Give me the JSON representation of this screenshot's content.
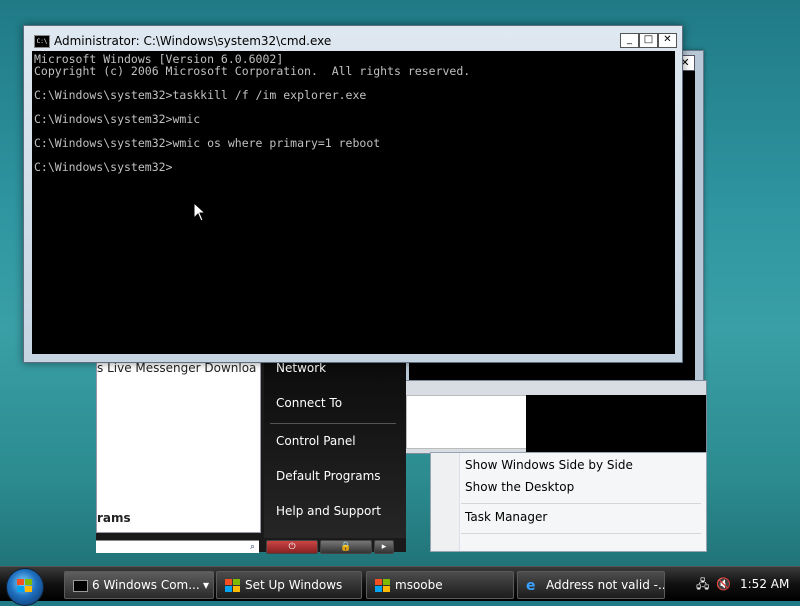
{
  "cmd_window": {
    "title": "Administrator: C:\\Windows\\system32\\cmd.exe",
    "icon_label": "C:\\",
    "minimize": "_",
    "maximize": "□",
    "close": "✕",
    "lines": [
      "Microsoft Windows [Version 6.0.6002]",
      "Copyright (c) 2006 Microsoft Corporation.  All rights reserved.",
      "",
      "C:\\Windows\\system32>taskkill /f /im explorer.exe",
      "",
      "C:\\Windows\\system32>wmic",
      "",
      "C:\\Windows\\system32>wmic os where primary=1 reboot",
      "",
      "C:\\Windows\\system32>"
    ]
  },
  "background_window": {
    "close": "✕"
  },
  "start_menu": {
    "left_item": "s Live Messenger Download",
    "all_programs": "rams",
    "right_items": [
      "Network",
      "Connect To",
      "Control Panel",
      "Default Programs",
      "Help and Support"
    ]
  },
  "context_menu": {
    "items": [
      "Show Windows Side by Side",
      "Show the Desktop",
      "Task Manager"
    ]
  },
  "taskbar": {
    "tasks": [
      {
        "label": "6 Windows Com...",
        "icon": "cmd-icon",
        "arrow": "▾"
      },
      {
        "label": "Set Up Windows",
        "icon": "windows-flag-icon"
      },
      {
        "label": "msoobe",
        "icon": "windows-flag-icon"
      },
      {
        "label": "Address not valid -...",
        "icon": "ie-icon"
      }
    ],
    "clock": "1:52 AM"
  }
}
